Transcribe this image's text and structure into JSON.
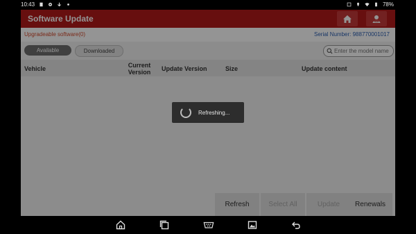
{
  "status_bar": {
    "time": "10:43",
    "battery": "78%"
  },
  "app": {
    "title": "Software Update",
    "upgradeable_label": "Upgradeable software(0)",
    "serial_label": "Serial Number:",
    "serial_value": "988770001017",
    "tabs": [
      {
        "label": "Available",
        "active": true
      },
      {
        "label": "Downloaded",
        "active": false
      }
    ],
    "search": {
      "placeholder": "Enter the model name",
      "icon": "search-icon"
    },
    "table": {
      "headers": {
        "vehicle": "Vehicle",
        "current_version": "Current Version",
        "update_version": "Update Version",
        "size": "Size",
        "update_content": "Update content"
      },
      "rows": []
    },
    "footer": {
      "refresh": "Refresh",
      "select_all": "Select All",
      "update": "Update",
      "renewals": "Renewals"
    }
  },
  "dialog": {
    "text": "Refreshing..."
  },
  "colors": {
    "title_bar": "#b21b1b",
    "upgradeable_text": "#d24a2e",
    "serial_text": "#2a5db0",
    "active_tab": "#6e6e6e"
  },
  "nav_icons": [
    "home-icon",
    "recents-icon",
    "vci-connector-icon",
    "gallery-icon",
    "back-icon"
  ]
}
